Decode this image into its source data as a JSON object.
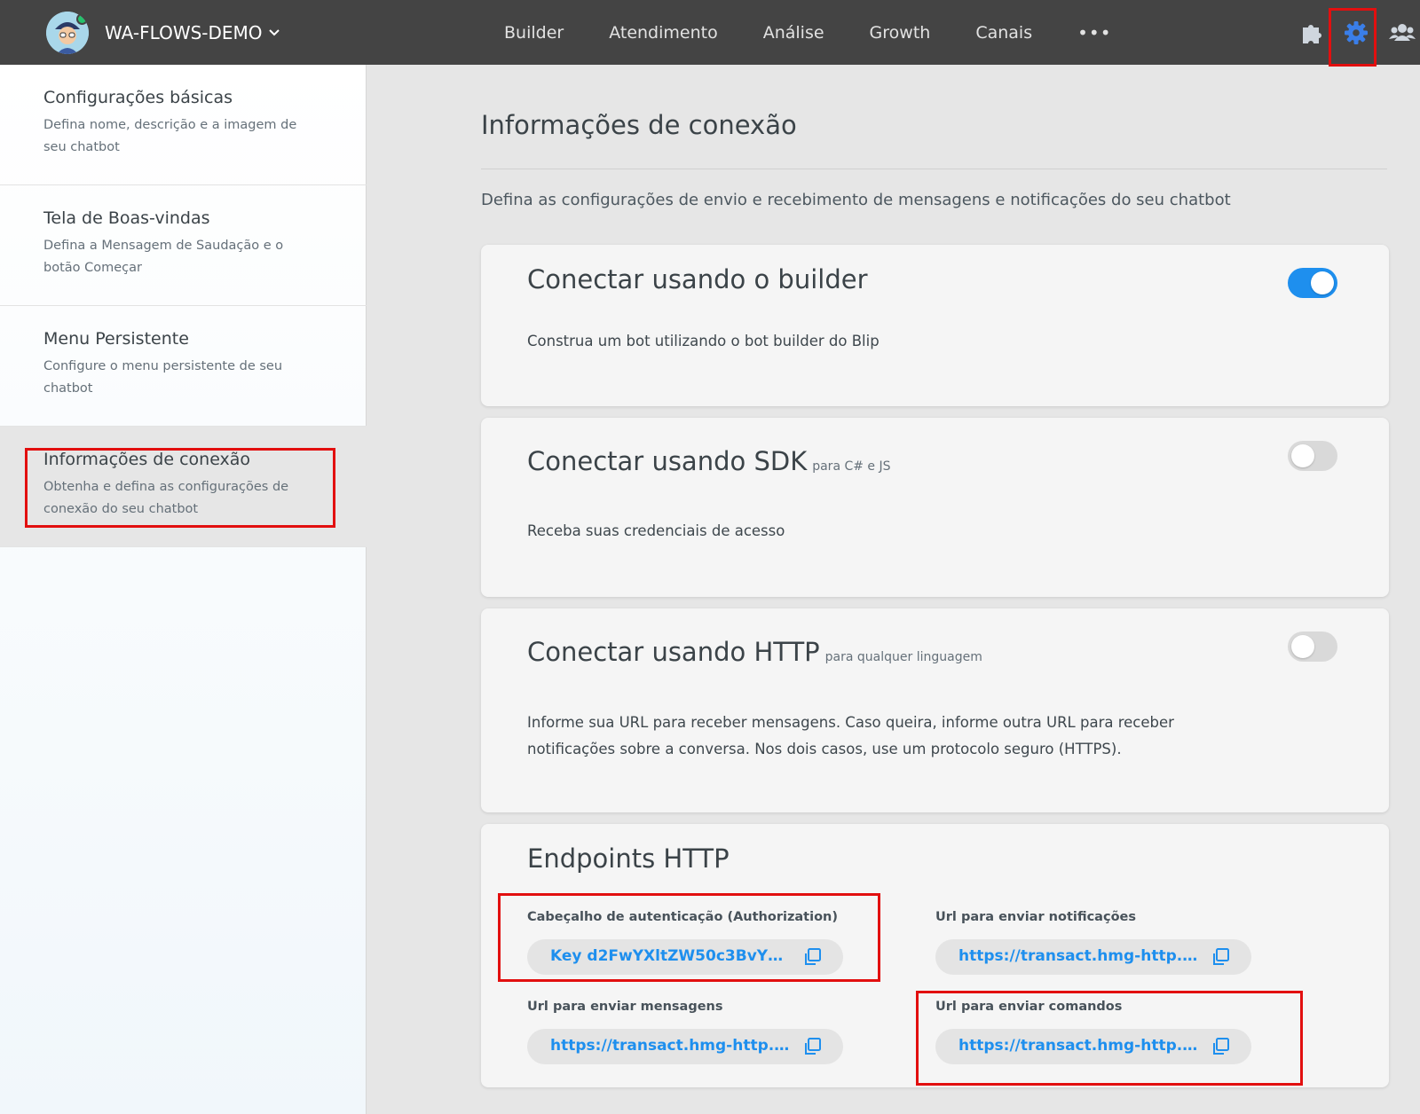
{
  "header": {
    "bot_name": "WA-FLOWS-DEMO",
    "tabs": [
      "Builder",
      "Atendimento",
      "Análise",
      "Growth",
      "Canais"
    ],
    "more_label": "•••",
    "icons": [
      "puzzle-icon",
      "gear-icon",
      "users-icon"
    ],
    "active_icon_color": "#3a7ee8"
  },
  "sidebar": {
    "items": [
      {
        "title": "Configurações básicas",
        "desc": "Defina nome, descrição e a imagem de seu chatbot"
      },
      {
        "title": "Tela de Boas-vindas",
        "desc": "Defina a Mensagem de Saudação e o botão Começar"
      },
      {
        "title": "Menu Persistente",
        "desc": "Configure o menu persistente de seu chatbot"
      },
      {
        "title": "Informações de conexão",
        "desc": "Obtenha e defina as configurações de conexão do seu chatbot"
      }
    ],
    "active_index": 3
  },
  "main": {
    "title": "Informações de conexão",
    "desc": "Defina as configurações de envio e recebimento de mensagens e notificações do seu chatbot",
    "cards": [
      {
        "title": "Conectar usando o builder",
        "subtitle": "",
        "text": "Construa um bot utilizando o bot builder do Blip",
        "enabled": true
      },
      {
        "title": "Conectar usando SDK",
        "subtitle": "para C# e JS",
        "text": "Receba suas credenciais de acesso",
        "enabled": false
      },
      {
        "title": "Conectar usando HTTP",
        "subtitle": "para qualquer linguagem",
        "text": "Informe sua URL para receber mensagens. Caso queira, informe outra URL para receber notificações sobre a conversa. Nos dois casos, use um protocolo seguro (HTTPS).",
        "enabled": false
      }
    ],
    "endpoints": {
      "title": "Endpoints HTTP",
      "fields": [
        {
          "label": "Cabeçalho de autenticação (Authorization)",
          "value": "Key d2FwYXltZW50c3BvY2..."
        },
        {
          "label": "Url para enviar notificações",
          "value": "https://transact.hmg-http.ms..."
        },
        {
          "label": "Url para enviar mensagens",
          "value": "https://transact.hmg-http.ms..."
        },
        {
          "label": "Url para enviar comandos",
          "value": "https://transact.hmg-http.ms..."
        }
      ]
    }
  },
  "colors": {
    "topbar": "#444444",
    "accent": "#1e8fee",
    "highlight": "#e20f0f"
  }
}
